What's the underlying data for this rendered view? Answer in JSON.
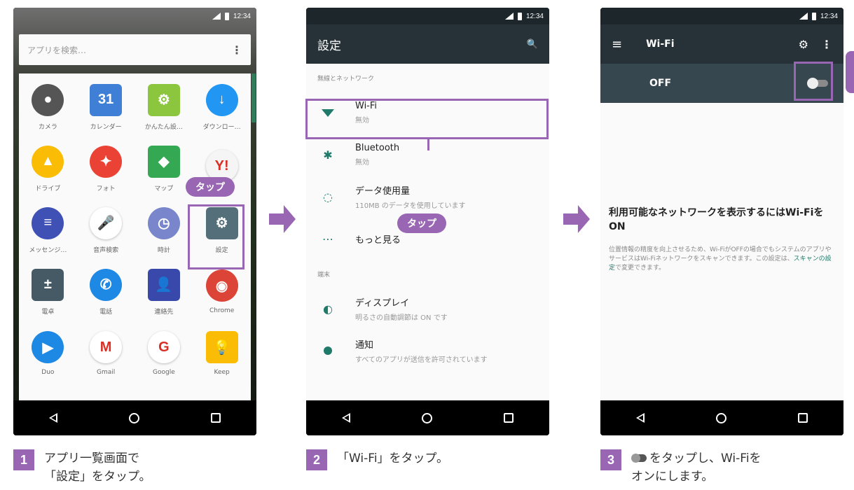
{
  "status_bar": {
    "time": "12:34"
  },
  "phone1": {
    "search_placeholder": "アプリを検索…",
    "menu_glyph": "⋮",
    "apps": [
      {
        "label": "カメラ",
        "icon": "camera-icon",
        "color": "#555555",
        "glyph": "●"
      },
      {
        "label": "カレンダー",
        "icon": "calendar-icon",
        "color": "#3f7fd6",
        "glyph": "31"
      },
      {
        "label": "かんたん設…",
        "icon": "easy-settings-icon",
        "color": "#8cc63f",
        "glyph": "⚙"
      },
      {
        "label": "ダウンロー…",
        "icon": "download-icon",
        "color": "#2196f3",
        "glyph": "↓"
      },
      {
        "label": "ドライブ",
        "icon": "drive-icon",
        "color": "#fbbc05",
        "glyph": "▲"
      },
      {
        "label": "フォト",
        "icon": "photos-icon",
        "color": "#ea4335",
        "glyph": "✦"
      },
      {
        "label": "マップ",
        "icon": "maps-icon",
        "color": "#34a853",
        "glyph": "◆"
      },
      {
        "label": "",
        "icon": "yahoo-icon",
        "color": "#f5f5f5",
        "glyph": "Y!"
      },
      {
        "label": "メッセンジ…",
        "icon": "messenger-icon",
        "color": "#3f51b5",
        "glyph": "≡"
      },
      {
        "label": "音声検索",
        "icon": "voice-search-icon",
        "color": "#ffffff",
        "glyph": "🎤"
      },
      {
        "label": "時計",
        "icon": "clock-icon",
        "color": "#7986cb",
        "glyph": "◷"
      },
      {
        "label": "設定",
        "icon": "settings-icon",
        "color": "#546e7a",
        "glyph": "⚙"
      },
      {
        "label": "電卓",
        "icon": "calculator-icon",
        "color": "#455a64",
        "glyph": "±"
      },
      {
        "label": "電話",
        "icon": "phone-icon",
        "color": "#1e88e5",
        "glyph": "✆"
      },
      {
        "label": "連絡先",
        "icon": "contacts-icon",
        "color": "#3949ab",
        "glyph": "👤"
      },
      {
        "label": "Chrome",
        "icon": "chrome-icon",
        "color": "#db4437",
        "glyph": "◉"
      },
      {
        "label": "Duo",
        "icon": "duo-icon",
        "color": "#1e88e5",
        "glyph": "▶"
      },
      {
        "label": "Gmail",
        "icon": "gmail-icon",
        "color": "#ffffff",
        "glyph": "M"
      },
      {
        "label": "Google",
        "icon": "google-icon",
        "color": "#ffffff",
        "glyph": "G"
      },
      {
        "label": "Keep",
        "icon": "keep-icon",
        "color": "#fbbc05",
        "glyph": "💡"
      }
    ],
    "tap_label": "タップ"
  },
  "phone2": {
    "title": "設定",
    "search_glyph": "🔍",
    "sections": [
      {
        "header": "無線とネットワーク"
      },
      {
        "header": "端末"
      }
    ],
    "rows": [
      {
        "title": "Wi-Fi",
        "subtitle": "無効",
        "icon": "wifi-icon"
      },
      {
        "title": "Bluetooth",
        "subtitle": "無効",
        "icon": "bluetooth-icon"
      },
      {
        "title": "データ使用量",
        "subtitle": "110MB のデータを使用しています",
        "icon": "data-usage-icon"
      },
      {
        "title": "もっと見る",
        "subtitle": "",
        "icon": "more-icon"
      },
      {
        "title": "ディスプレイ",
        "subtitle": "明るさの自動調節は ON です",
        "icon": "display-icon"
      },
      {
        "title": "通知",
        "subtitle": "すべてのアプリが送信を許可されています",
        "icon": "notification-icon"
      }
    ],
    "tap_label": "タップ"
  },
  "phone3": {
    "title": "Wi-Fi",
    "menu_glyph": "≡",
    "gear_glyph": "⚙",
    "kebab_glyph": "⋮",
    "switch_label": "OFF",
    "switch_on": false,
    "message_title": "利用可能なネットワークを表示するにはWi-FiをON",
    "message_body": "位置情報の精度を向上させるため、Wi-FiがOFFの場合でもシステムのアプリやサービスはWi-Fiネットワークをスキャンできます。この設定は、",
    "message_link": "スキャンの設定",
    "message_tail": "で変更できます。"
  },
  "steps": [
    {
      "num": "1",
      "line1": "アプリ一覧画面で",
      "line2": "「設定」をタップ。"
    },
    {
      "num": "2",
      "line1": "「Wi-Fi」をタップ。",
      "line2": ""
    },
    {
      "num": "3",
      "line1": "をタップし、Wi-Fiを",
      "line2": "オンにします。"
    }
  ],
  "colors": {
    "accent": "#9966b3",
    "teal": "#1f7a6a",
    "appbar": "#263238"
  }
}
